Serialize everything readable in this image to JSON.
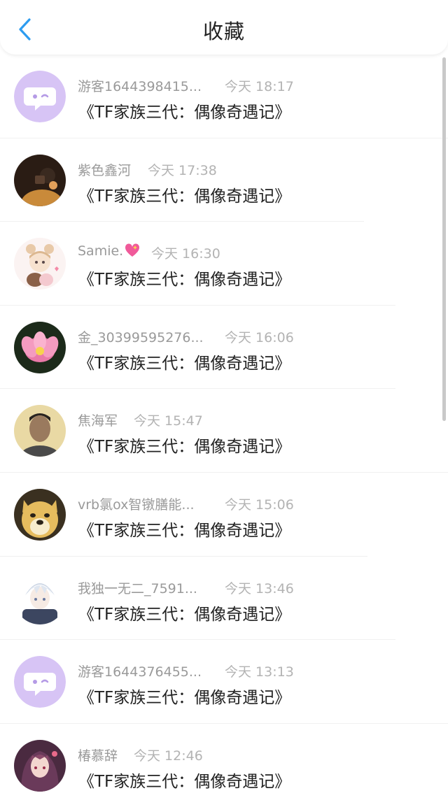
{
  "header": {
    "title": "收藏",
    "back_icon": "chevron-left-icon",
    "accent_color": "#2d9cf0"
  },
  "items": [
    {
      "name": "游客1644398415...",
      "time": "今天 18:17",
      "book": "《TF家族三代：偶像奇遇记》",
      "avatar": "default-chat-bubble-avatar"
    },
    {
      "name": "紫色鑫河",
      "time": "今天 17:38",
      "book": "《TF家族三代：偶像奇遇记》",
      "avatar": "user-photo-avatar"
    },
    {
      "name": "Samie.",
      "time": "今天 16:30",
      "book": "《TF家族三代：偶像奇遇记》",
      "avatar": "anime-girl-avatar",
      "badge": "sparkling-heart-icon"
    },
    {
      "name": "金_30399595276...",
      "time": "今天 16:06",
      "book": "《TF家族三代：偶像奇遇记》",
      "avatar": "lotus-flower-avatar"
    },
    {
      "name": "焦海军",
      "time": "今天 15:47",
      "book": "《TF家族三代：偶像奇遇记》",
      "avatar": "user-photo-avatar"
    },
    {
      "name": "vrb氯ox智镦膳能...",
      "time": "今天 15:06",
      "book": "《TF家族三代：偶像奇遇记》",
      "avatar": "doge-avatar"
    },
    {
      "name": "我独一无二_7591...",
      "time": "今天 13:46",
      "book": "《TF家族三代：偶像奇遇记》",
      "avatar": "anime-boy-avatar"
    },
    {
      "name": "游客1644376455...",
      "time": "今天 13:13",
      "book": "《TF家族三代：偶像奇遇记》",
      "avatar": "default-chat-bubble-avatar"
    },
    {
      "name": "椿慕辞",
      "time": "今天 12:46",
      "book": "《TF家族三代：偶像奇遇记》",
      "avatar": "anime-girl-avatar"
    }
  ]
}
